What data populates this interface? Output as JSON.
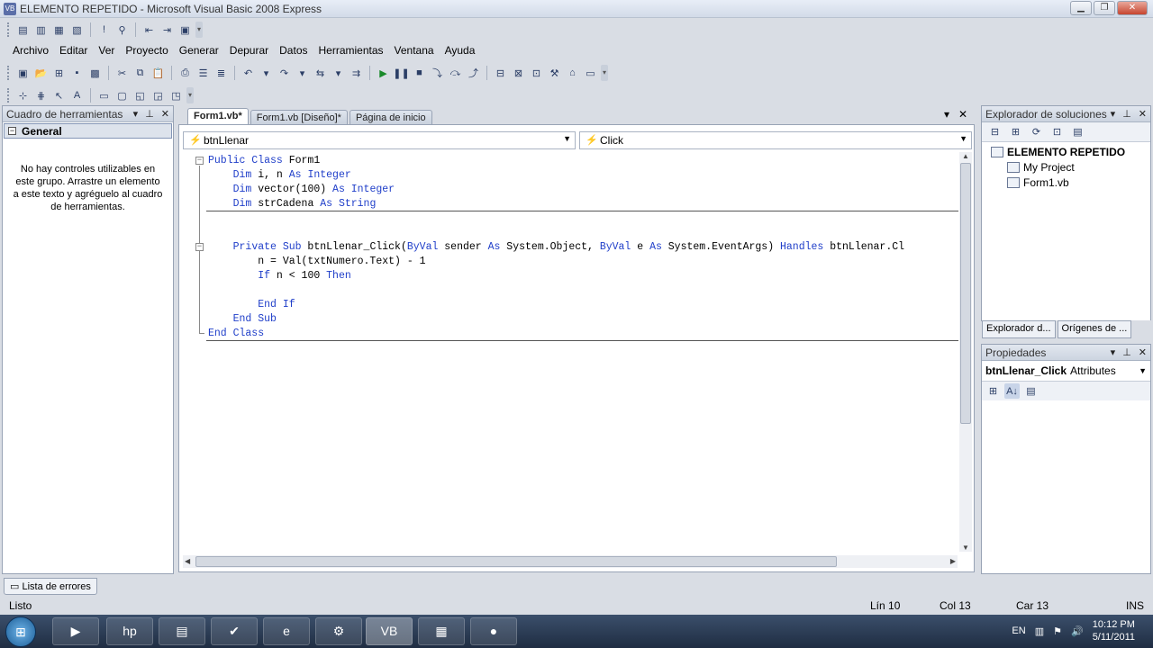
{
  "window": {
    "title": "ELEMENTO REPETIDO - Microsoft Visual Basic 2008 Express"
  },
  "menu": [
    "Archivo",
    "Editar",
    "Ver",
    "Proyecto",
    "Generar",
    "Depurar",
    "Datos",
    "Herramientas",
    "Ventana",
    "Ayuda"
  ],
  "toolbox": {
    "title": "Cuadro de herramientas",
    "group": "General",
    "empty_text": "No hay controles utilizables en este grupo. Arrastre un elemento a este texto y agréguelo al cuadro de herramientas."
  },
  "editor": {
    "tabs": [
      "Form1.vb*",
      "Form1.vb [Diseño]*",
      "Página de inicio"
    ],
    "object_combo": "btnLlenar",
    "event_combo": "Click"
  },
  "solution": {
    "title": "Explorador de soluciones",
    "items": [
      "ELEMENTO REPETIDO",
      "My Project",
      "Form1.vb"
    ],
    "bottom_tabs": [
      "Explorador d...",
      "Orígenes de ..."
    ]
  },
  "properties": {
    "title": "Propiedades",
    "object": "btnLlenar_Click",
    "type": "Attributes"
  },
  "error_list": "Lista de errores",
  "status": {
    "ready": "Listo",
    "line": "Lín 10",
    "col": "Col 13",
    "char": "Car 13",
    "mode": "INS"
  },
  "taskbar": {
    "lang": "EN",
    "time": "10:12 PM",
    "date": "5/11/2011"
  }
}
